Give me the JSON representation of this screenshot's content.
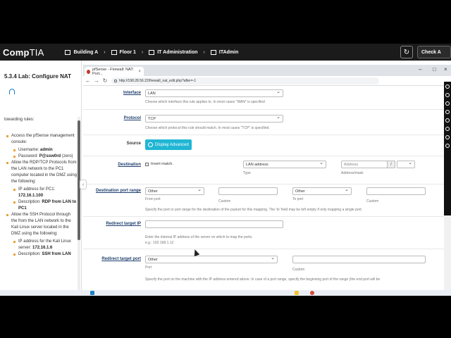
{
  "app": {
    "logo_main": "Comp",
    "logo_sub": "TIA",
    "breadcrumbs": [
      "Building A",
      "Floor 1",
      "IT Administration",
      "ITAdmin"
    ],
    "check_button": "Check A"
  },
  "lab": {
    "title": "5.3.4 Lab: Configure NAT",
    "intro": "towarding rules:",
    "steps": [
      {
        "text": "Access the pfSense management console:",
        "subs": [
          {
            "label": "Username: ",
            "value": "admin"
          },
          {
            "label": "Password: ",
            "value": "P@ssw0rd",
            "suffix": " (zero)"
          }
        ]
      },
      {
        "text": "Allow the RDP/TCP Protocols from the LAN network to the PC1 computer located in the DMZ using the following:",
        "subs": [
          {
            "label": "IP address for PC1: ",
            "value": "172.16.1.100"
          },
          {
            "label": "Description: ",
            "value": "RDP from LAN to PC1"
          }
        ]
      },
      {
        "text": "Allow the SSH Protocol through the from the LAN network to the Kali Linux server located in the DMZ using the following:",
        "subs": [
          {
            "label": "IP address for the Kali Linux server: ",
            "value": "172.16.1.6"
          },
          {
            "label": "Description: ",
            "value": "SSH from LAN"
          }
        ]
      }
    ]
  },
  "browser": {
    "tab_title": "pfSense - Firewall: NAT: Port...",
    "url": "http://198.28.56.22/firewall_nat_edit.php?after=-1"
  },
  "form": {
    "interface": {
      "label": "Interface",
      "value": "LAN",
      "help": "Choose which interface this rule applies to. In most cases \"WAN\" is specified"
    },
    "protocol": {
      "label": "Protocol",
      "value": "TCP",
      "help": "Choose which protocol this rule should match. In most cases \"TCP\" is specified."
    },
    "source": {
      "label": "Source",
      "button": "Display Advanced"
    },
    "destination": {
      "label": "Destination",
      "invert": "Invert match.",
      "type_value": "LAN address",
      "type_label": "Type",
      "address_placeholder": "Address",
      "slash": "/",
      "address_label": "Address/mask"
    },
    "dest_port": {
      "label": "Destination port range",
      "from_value": "Other",
      "from_label": "From port",
      "custom_label": "Custom",
      "to_value": "Other",
      "to_label": "To port",
      "custom2_label": "Custom",
      "help": "Specify the port or port range for the destination of the packet for this mapping. The 'to' field may be left empty if only mapping a single port."
    },
    "redirect_ip": {
      "label": "Redirect target IP",
      "help1": "Enter the internal IP address of the server on which to map the ports.",
      "help2": "e.g.: 192.168.1.12"
    },
    "redirect_port": {
      "label": "Redirect target port",
      "value": "Other",
      "port_label": "Port",
      "custom_label": "Custom",
      "help": "Specify the port on the machine with the IP address entered above. In case of a port range, specify the beginning port of the range (the end port will be"
    }
  },
  "colors": {
    "accent": "#20b6d4",
    "bullet": "#e8a33a",
    "link": "#1f3f6e"
  }
}
